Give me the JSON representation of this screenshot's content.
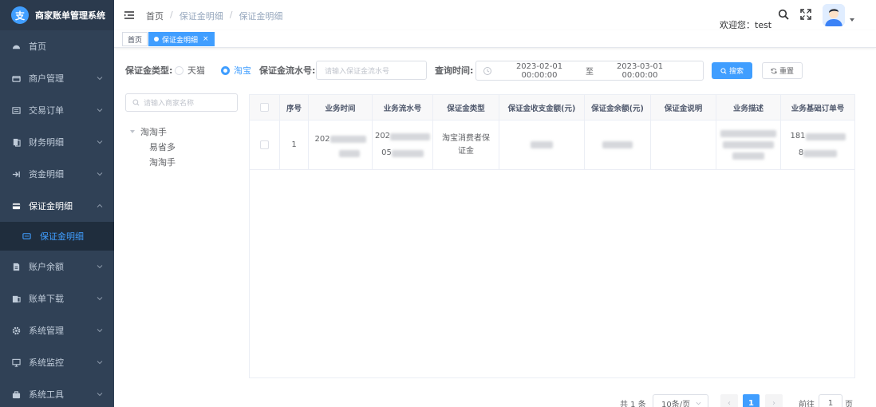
{
  "app": {
    "title": "商家账单管理系统",
    "logo_glyph": "支"
  },
  "sidebar": {
    "items": [
      {
        "label": "首页",
        "icon": "dashboard-icon",
        "expandable": false
      },
      {
        "label": "商户管理",
        "icon": "merchant-icon",
        "expandable": true
      },
      {
        "label": "交易订单",
        "icon": "order-icon",
        "expandable": true
      },
      {
        "label": "财务明细",
        "icon": "finance-icon",
        "expandable": true
      },
      {
        "label": "资金明细",
        "icon": "fund-icon",
        "expandable": true
      },
      {
        "label": "保证金明细",
        "icon": "deposit-icon",
        "expandable": true,
        "open": true
      },
      {
        "label": "账户余额",
        "icon": "balance-icon",
        "expandable": true
      },
      {
        "label": "账单下载",
        "icon": "download-icon",
        "expandable": true
      },
      {
        "label": "系统管理",
        "icon": "system-icon",
        "expandable": true
      },
      {
        "label": "系统监控",
        "icon": "monitor-icon",
        "expandable": true
      },
      {
        "label": "系统工具",
        "icon": "tool-icon",
        "expandable": true
      }
    ],
    "sub_item": {
      "label": "保证金明细",
      "icon": "list-icon"
    }
  },
  "header": {
    "breadcrumb": [
      "首页",
      "保证金明细",
      "保证金明细"
    ],
    "separator": "/",
    "welcome": "欢迎您：test"
  },
  "tags": [
    {
      "label": "首页",
      "active": false
    },
    {
      "label": "保证金明细",
      "active": true,
      "close": "×"
    }
  ],
  "filter": {
    "type_label": "保证金类型:",
    "type_options": [
      {
        "label": "天猫",
        "checked": false
      },
      {
        "label": "淘宝",
        "checked": true
      }
    ],
    "serial_label": "保证金流水号:",
    "serial_placeholder": "请输入保证金流水号",
    "time_label": "查询时间:",
    "date_start": "2023-02-01 00:00:00",
    "date_sep": "至",
    "date_end": "2023-03-01 00:00:00",
    "search_btn": "搜索",
    "reset_btn": "重置"
  },
  "tree": {
    "search_placeholder": "请输入商家名称",
    "root": "淘淘手",
    "children": [
      "易省多",
      "淘淘手"
    ]
  },
  "table": {
    "headers": [
      "序号",
      "业务时间",
      "业务流水号",
      "保证金类型",
      "保证金收支金额(元)",
      "保证金余额(元)",
      "保证金说明",
      "业务描述",
      "业务基础订单号"
    ],
    "rows": [
      {
        "index": "1",
        "time_prefix": "202",
        "serial_prefix_1": "202",
        "serial_prefix_2": "05",
        "type": "淘宝消费者保证金",
        "order_prefix_1": "181",
        "order_prefix_2": "8"
      }
    ]
  },
  "pagination": {
    "total": "共 1 条",
    "page_size": "10条/页",
    "prev": "‹",
    "current": "1",
    "next": "›",
    "jump_label": "前往",
    "jump_value": "1",
    "jump_suffix": "页"
  }
}
